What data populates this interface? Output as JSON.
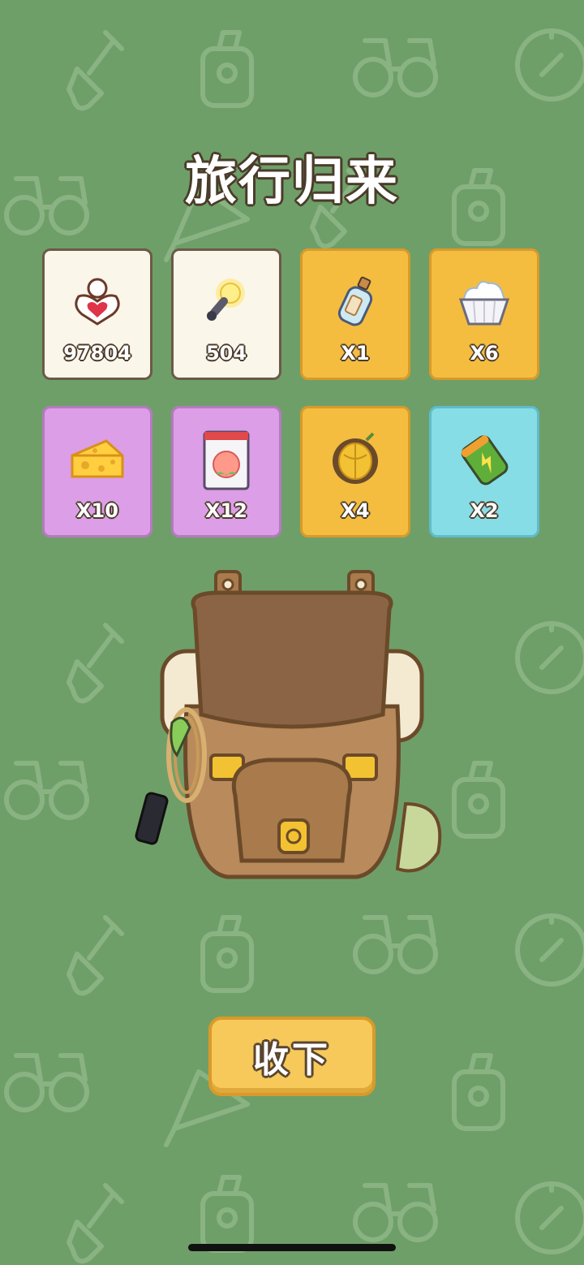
{
  "title": "旅行归来",
  "rewards": [
    {
      "icon": "clover-heart-icon",
      "label": "97804",
      "rarity": "cream"
    },
    {
      "icon": "lightbulb-icon",
      "label": "504",
      "rarity": "cream"
    },
    {
      "icon": "message-bottle-icon",
      "label": "X1",
      "rarity": "gold"
    },
    {
      "icon": "cupcake-icon",
      "label": "X6",
      "rarity": "gold"
    },
    {
      "icon": "cheese-icon",
      "label": "X10",
      "rarity": "purple"
    },
    {
      "icon": "peach-seed-pack-icon",
      "label": "X12",
      "rarity": "purple"
    },
    {
      "icon": "durian-icon",
      "label": "X4",
      "rarity": "gold"
    },
    {
      "icon": "battery-can-icon",
      "label": "X2",
      "rarity": "cyan"
    }
  ],
  "collect_button": "收下",
  "colors": {
    "background": "#6f9f68",
    "cream": "#fbf6ea",
    "gold": "#f4bd3f",
    "purple": "#dc9ee6",
    "cyan": "#86dde6",
    "button": "#f6c95a"
  }
}
